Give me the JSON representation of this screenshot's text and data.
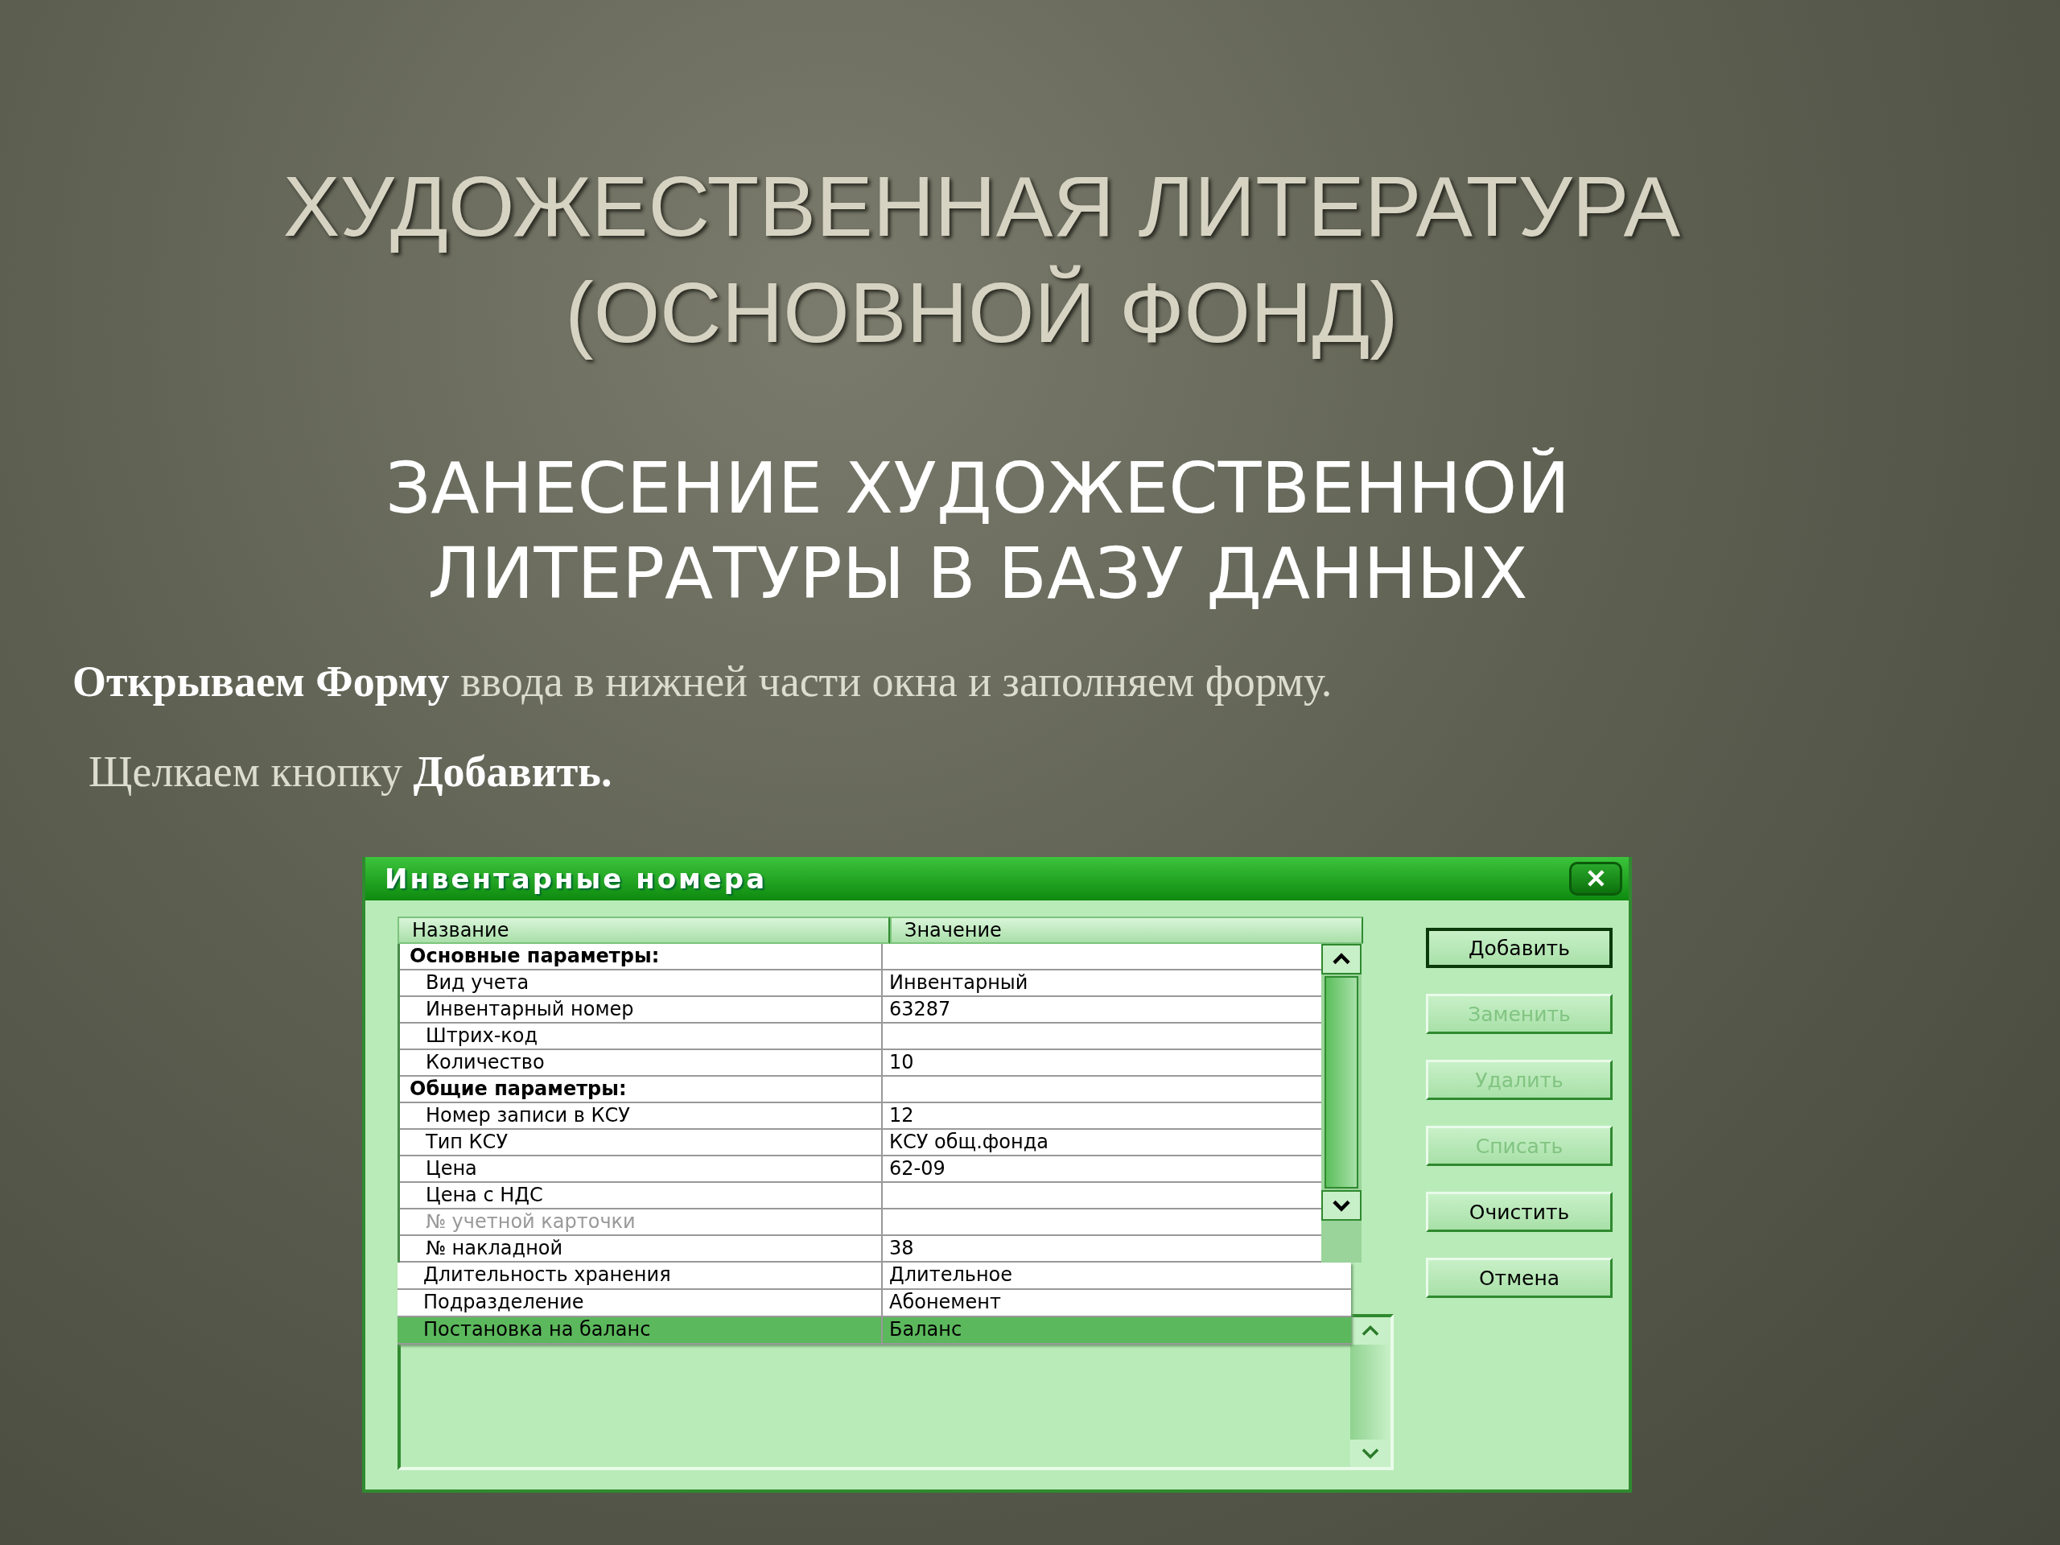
{
  "slide": {
    "title_lines": [
      "ХУДОЖЕСТВЕННАЯ ЛИТЕРАТУРА",
      "(ОСНОВНОЙ ФОНД)"
    ],
    "subtitle_lines": [
      "ЗАНЕСЕНИЕ ХУДОЖЕСТВЕННОЙ",
      "ЛИТЕРАТУРЫ В БАЗУ ДАННЫХ"
    ],
    "paragraphs": [
      "**Открываем Форму** ввода в нижней части окна и заполняем форму.",
      "Щелкаем кнопку **Добавить.**"
    ]
  },
  "window": {
    "title": "Инвентарные номера",
    "close_label": "✕",
    "table": {
      "columns": [
        "Название",
        "Значение"
      ],
      "rows": [
        {
          "kind": "group",
          "name": "Основные параметры:",
          "value": "",
          "disabled": false
        },
        {
          "kind": "field",
          "name": "Вид учета",
          "value": "Инвентарный",
          "disabled": false
        },
        {
          "kind": "field",
          "name": "Инвентарный номер",
          "value": "63287",
          "disabled": false
        },
        {
          "kind": "field",
          "name": "Штрих-код",
          "value": "",
          "disabled": false
        },
        {
          "kind": "field",
          "name": "Количество",
          "value": "10",
          "disabled": false
        },
        {
          "kind": "group",
          "name": "Общие параметры:",
          "value": "",
          "disabled": false
        },
        {
          "kind": "field",
          "name": "Номер записи в КСУ",
          "value": "12",
          "disabled": false
        },
        {
          "kind": "field",
          "name": "Тип КСУ",
          "value": "КСУ общ.фонда",
          "disabled": false
        },
        {
          "kind": "field",
          "name": "Цена",
          "value": "62-09",
          "disabled": false
        },
        {
          "kind": "field",
          "name": "Цена с НДС",
          "value": "",
          "disabled": false
        },
        {
          "kind": "field",
          "name": "№ учетной карточки",
          "value": "",
          "disabled": true
        },
        {
          "kind": "field",
          "name": "№ накладной",
          "value": "38",
          "disabled": false
        }
      ],
      "overflow_rows": [
        {
          "name": "Длительность хранения",
          "value": "Длительное",
          "selected": false
        },
        {
          "name": "Подразделение",
          "value": "Абонемент",
          "selected": false
        },
        {
          "name": "Постановка на баланс",
          "value": "Баланс",
          "selected": true
        }
      ]
    },
    "buttons": [
      {
        "label": "Добавить",
        "disabled": false,
        "default": true
      },
      {
        "label": "Заменить",
        "disabled": true,
        "default": false
      },
      {
        "label": "Удалить",
        "disabled": true,
        "default": false
      },
      {
        "label": "Списать",
        "disabled": true,
        "default": false
      },
      {
        "label": "Очистить",
        "disabled": false,
        "default": false
      },
      {
        "label": "Отмена",
        "disabled": false,
        "default": false
      }
    ]
  }
}
